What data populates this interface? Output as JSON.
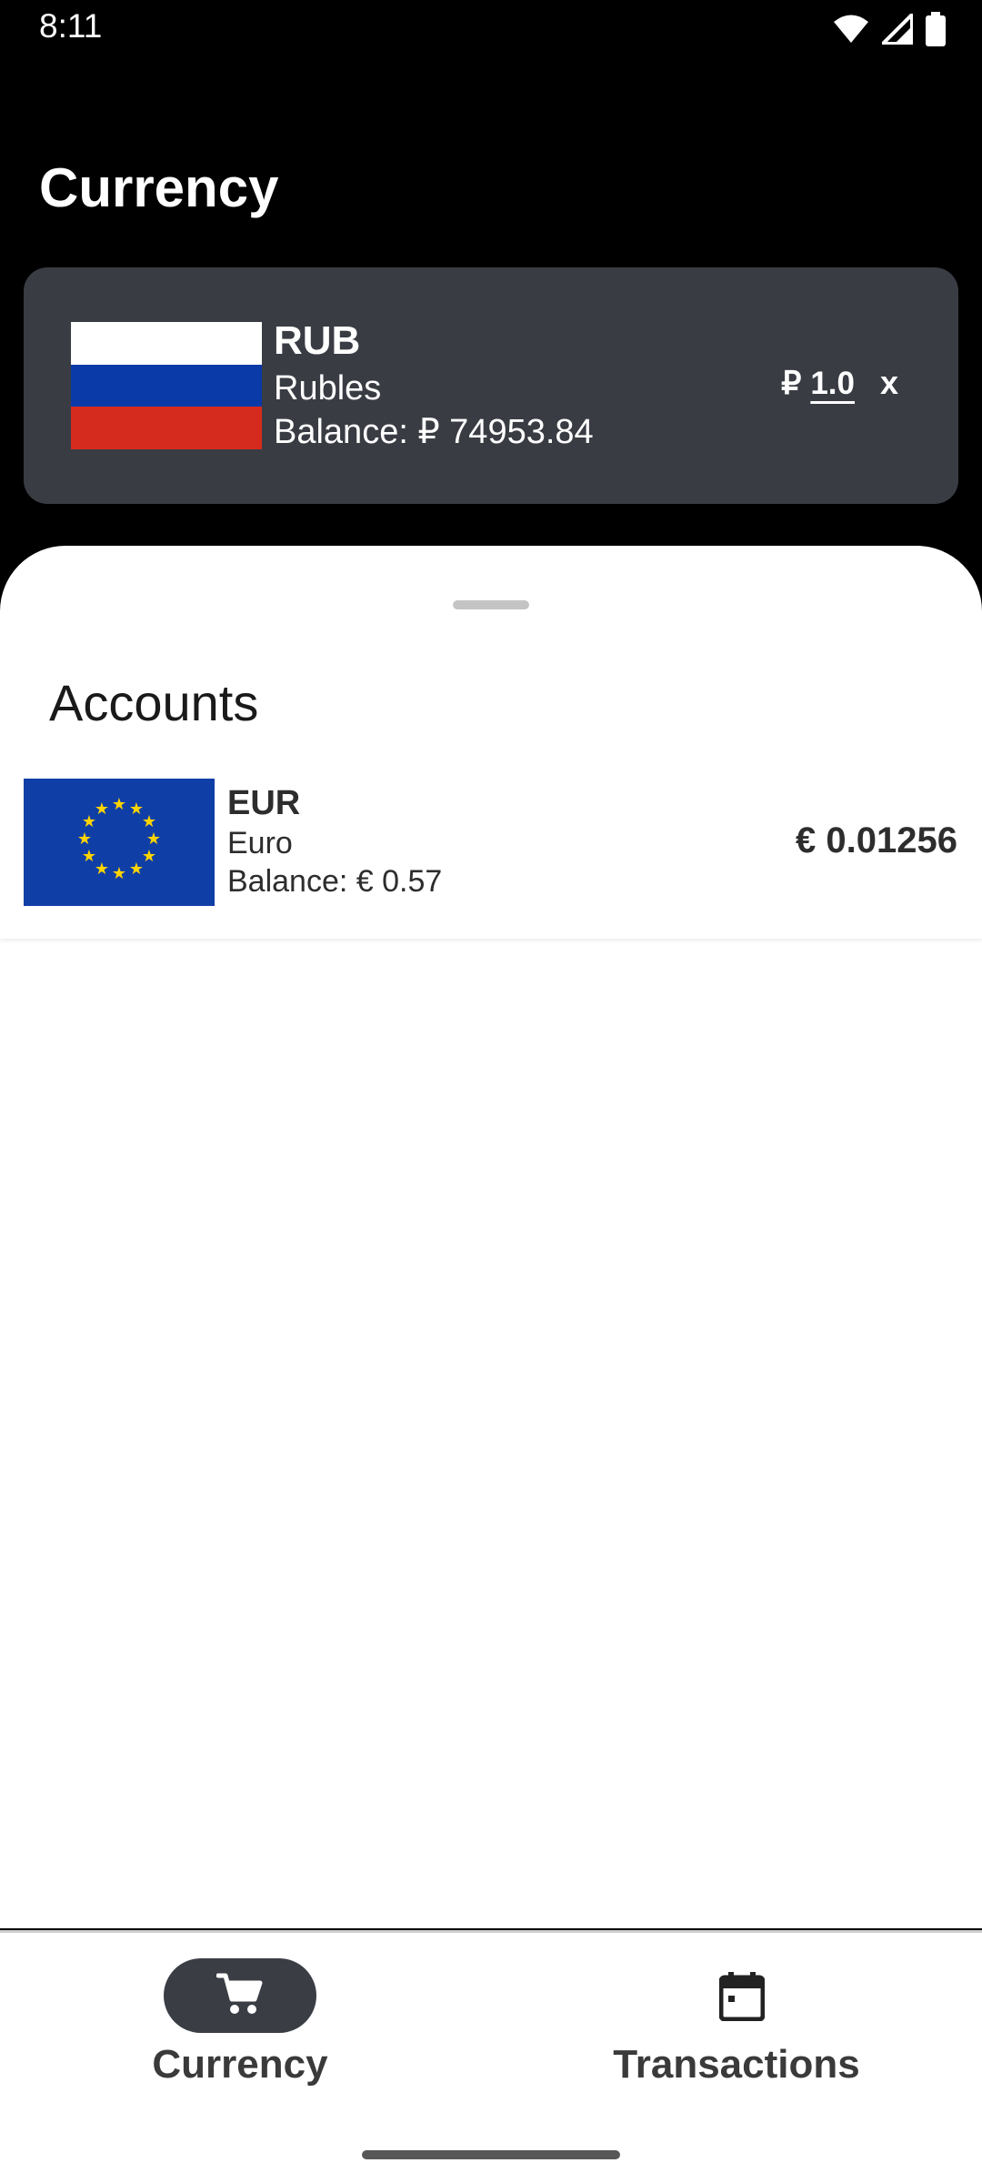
{
  "status_bar": {
    "time": "8:11",
    "icons": [
      "wifi-icon",
      "signal-icon",
      "battery-icon"
    ]
  },
  "header": {
    "title": "Currency"
  },
  "selected_currency": {
    "code": "RUB",
    "name": "Rubles",
    "balance": "Balance: ₽ 74953.84",
    "rate_symbol": "₽",
    "rate_value": "1.0",
    "remove_label": "x",
    "flag": "russia-flag",
    "flag_colors": [
      "#ffffff",
      "#0a3aa8",
      "#d52b1e"
    ]
  },
  "accounts_sheet": {
    "title": "Accounts",
    "items": [
      {
        "code": "EUR",
        "name": "Euro",
        "balance": "Balance: € 0.57",
        "rate": "€ 0.01256",
        "flag": "eu-flag",
        "flag_colors": [
          "#0f3fa6",
          "#ffd400"
        ]
      }
    ]
  },
  "bottom_nav": {
    "items": [
      {
        "label": "Currency",
        "icon": "cart-icon",
        "active": true
      },
      {
        "label": "Transactions",
        "icon": "calendar-icon",
        "active": false
      }
    ]
  },
  "colors": {
    "background": "#000000",
    "card": "#393c43",
    "sheet": "#ffffff",
    "nav_active_pill": "#3a3d44",
    "text_dark": "#2d2d2d"
  }
}
